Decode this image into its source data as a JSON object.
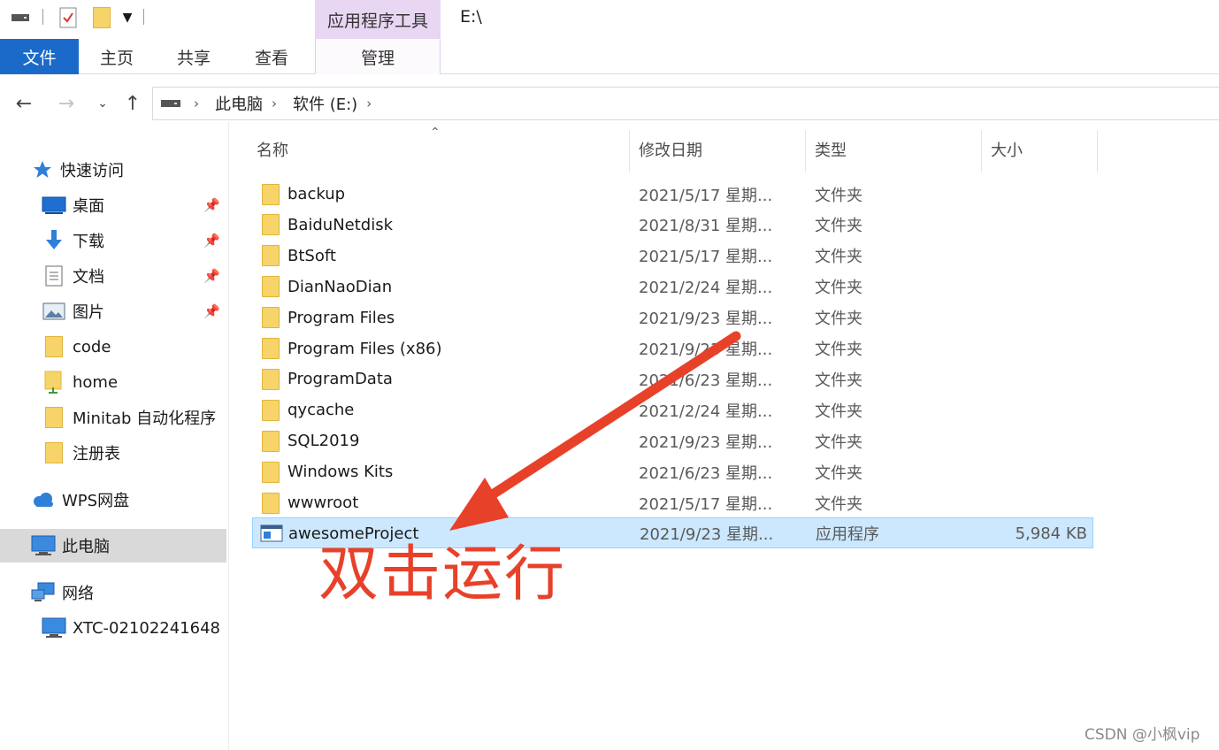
{
  "window": {
    "address_title": "E:\\"
  },
  "ribbon": {
    "context_group": "应用程序工具",
    "tabs": [
      {
        "label": "文件"
      },
      {
        "label": "主页"
      },
      {
        "label": "共享"
      },
      {
        "label": "查看"
      },
      {
        "label": "管理"
      }
    ]
  },
  "address": {
    "breadcrumbs": [
      "此电脑",
      "软件 (E:)"
    ]
  },
  "sidebar": {
    "items": [
      {
        "label": "快速访问",
        "icon": "star-icon"
      },
      {
        "label": "桌面",
        "icon": "desktop-icon",
        "pinned": true
      },
      {
        "label": "下载",
        "icon": "download-icon",
        "pinned": true
      },
      {
        "label": "文档",
        "icon": "document-icon",
        "pinned": true
      },
      {
        "label": "图片",
        "icon": "picture-icon",
        "pinned": true
      },
      {
        "label": "code",
        "icon": "folder-icon"
      },
      {
        "label": "home",
        "icon": "folder-icon"
      },
      {
        "label": "Minitab 自动化程序",
        "icon": "folder-icon"
      },
      {
        "label": "注册表",
        "icon": "folder-icon"
      },
      {
        "label": "WPS网盘",
        "icon": "cloud-icon"
      },
      {
        "label": "此电脑",
        "icon": "computer-icon",
        "selected": true
      },
      {
        "label": "网络",
        "icon": "network-icon"
      },
      {
        "label": "XTC-02102241648",
        "icon": "computer-icon"
      }
    ]
  },
  "list": {
    "columns": {
      "name": "名称",
      "date": "修改日期",
      "type": "类型",
      "size": "大小"
    },
    "rows": [
      {
        "name": "backup",
        "date": "2021/5/17 星期...",
        "type": "文件夹",
        "size": ""
      },
      {
        "name": "BaiduNetdisk",
        "date": "2021/8/31 星期...",
        "type": "文件夹",
        "size": ""
      },
      {
        "name": "BtSoft",
        "date": "2021/5/17 星期...",
        "type": "文件夹",
        "size": ""
      },
      {
        "name": "DianNaoDian",
        "date": "2021/2/24 星期...",
        "type": "文件夹",
        "size": ""
      },
      {
        "name": "Program Files",
        "date": "2021/9/23 星期...",
        "type": "文件夹",
        "size": ""
      },
      {
        "name": "Program Files (x86)",
        "date": "2021/9/23 星期...",
        "type": "文件夹",
        "size": ""
      },
      {
        "name": "ProgramData",
        "date": "2021/6/23 星期...",
        "type": "文件夹",
        "size": ""
      },
      {
        "name": "qycache",
        "date": "2021/2/24 星期...",
        "type": "文件夹",
        "size": ""
      },
      {
        "name": "SQL2019",
        "date": "2021/9/23 星期...",
        "type": "文件夹",
        "size": ""
      },
      {
        "name": "Windows Kits",
        "date": "2021/6/23 星期...",
        "type": "文件夹",
        "size": ""
      },
      {
        "name": "wwwroot",
        "date": "2021/5/17 星期...",
        "type": "文件夹",
        "size": ""
      },
      {
        "name": "awesomeProject",
        "date": "2021/9/23 星期...",
        "type": "应用程序",
        "size": "5,984 KB",
        "selected": true
      }
    ]
  },
  "annotation": {
    "text": "双击运行",
    "color": "#e8412a"
  },
  "watermark": "CSDN @小枫vip",
  "colors": {
    "accent": "#1b6ac9",
    "context_tab": "#e9d6f2",
    "selection": "#cce8ff"
  }
}
